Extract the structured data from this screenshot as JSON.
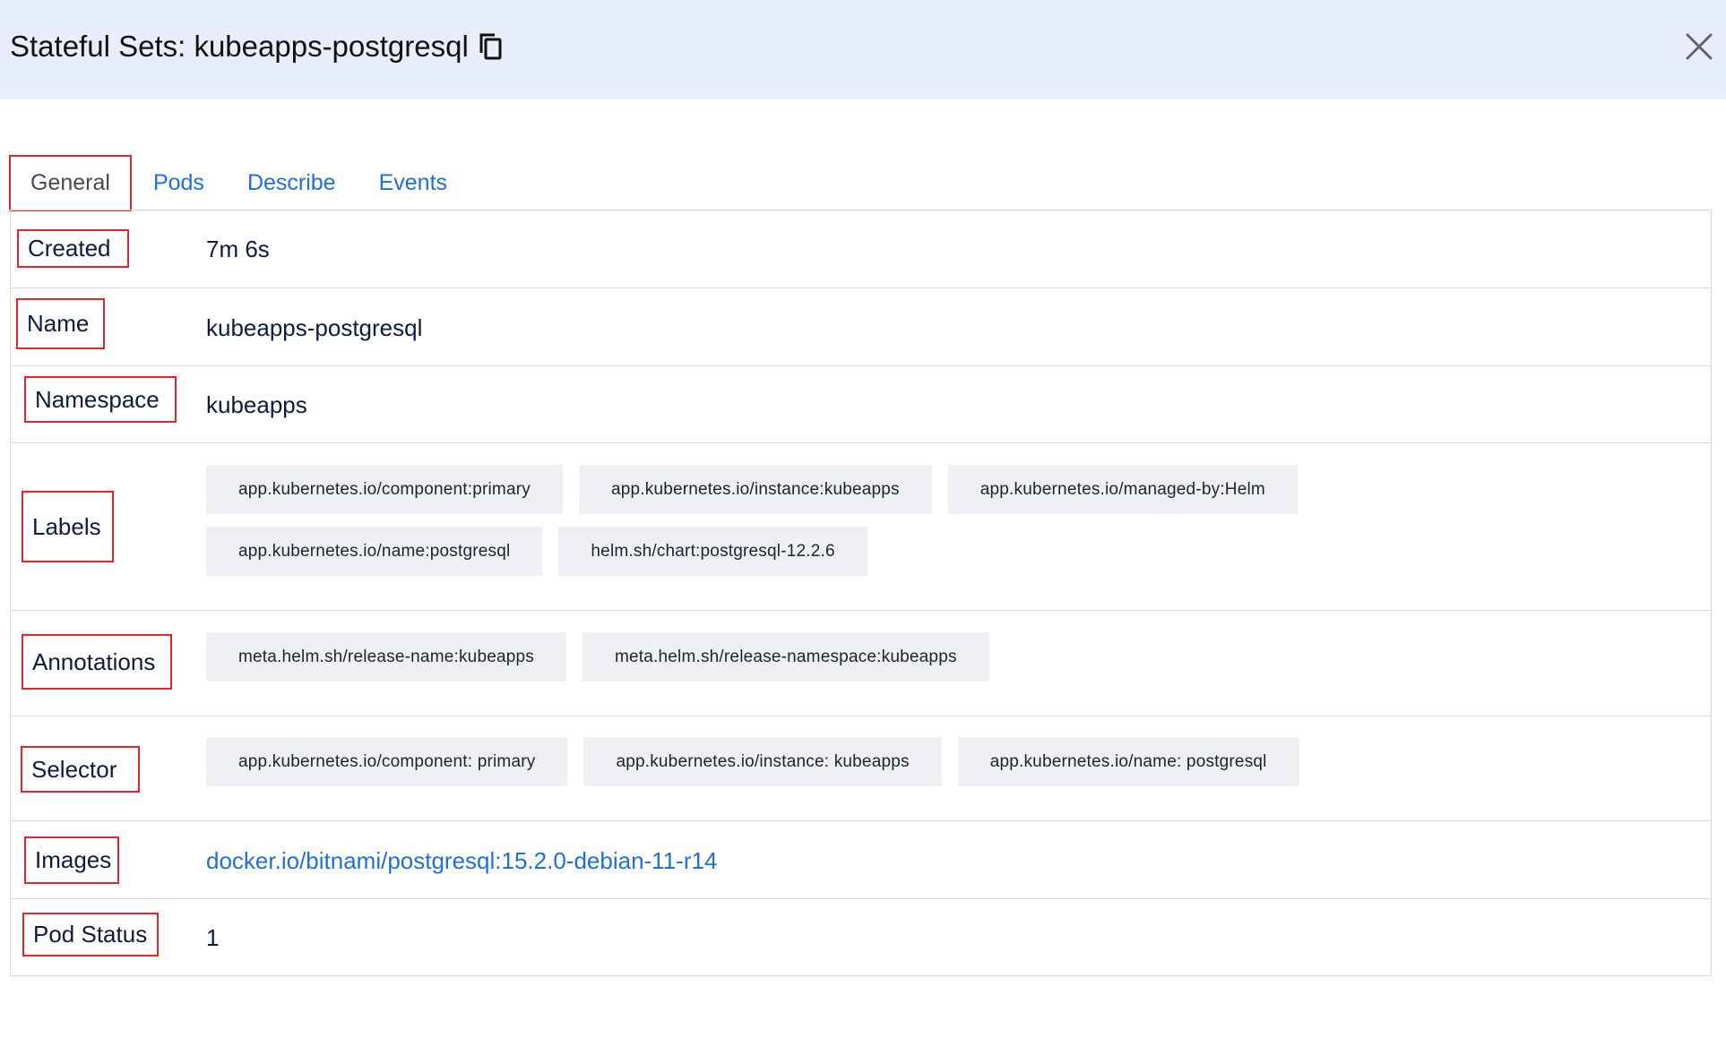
{
  "header": {
    "title": "Stateful Sets: kubeapps-postgresql",
    "copy_icon": "copy-icon",
    "close_icon": "close-icon",
    "background": "#e8eefb"
  },
  "tabs": [
    {
      "label": "General",
      "active": true
    },
    {
      "label": "Pods",
      "active": false
    },
    {
      "label": "Describe",
      "active": false
    },
    {
      "label": "Events",
      "active": false
    }
  ],
  "details": {
    "created": {
      "label": "Created",
      "value": "7m 6s"
    },
    "name": {
      "label": "Name",
      "value": "kubeapps-postgresql"
    },
    "namespace": {
      "label": "Namespace",
      "value": "kubeapps"
    },
    "labels": {
      "label": "Labels",
      "items": [
        "app.kubernetes.io/component:primary",
        "app.kubernetes.io/instance:kubeapps",
        "app.kubernetes.io/managed-by:Helm",
        "app.kubernetes.io/name:postgresql",
        "helm.sh/chart:postgresql-12.2.6"
      ]
    },
    "annotations": {
      "label": "Annotations",
      "items": [
        "meta.helm.sh/release-name:kubeapps",
        "meta.helm.sh/release-namespace:kubeapps"
      ]
    },
    "selector": {
      "label": "Selector",
      "items": [
        "app.kubernetes.io/component: primary",
        "app.kubernetes.io/instance: kubeapps",
        "app.kubernetes.io/name: postgresql"
      ]
    },
    "images": {
      "label": "Images",
      "value": "docker.io/bitnami/postgresql:15.2.0-debian-11-r14"
    },
    "pod_status": {
      "label": "Pod Status",
      "value": "1"
    }
  },
  "colors": {
    "accent_link": "#1f6fd6",
    "highlight_border": "#e3262e",
    "chip_bg": "#eef0f3"
  }
}
